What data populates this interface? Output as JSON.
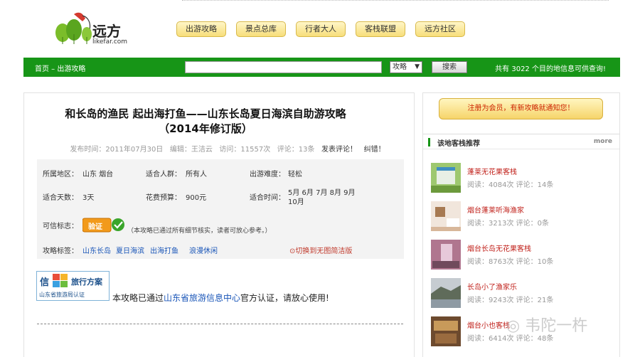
{
  "header": {
    "logo_text": "远方",
    "logo_sub": "likefar.com",
    "nav": [
      "出游攻略",
      "景点总库",
      "行者大人",
      "客栈联盟",
      "远方社区"
    ]
  },
  "searchbar": {
    "breadcrumb": "首页 – 出游攻略",
    "search_value": "",
    "select_value": "攻略",
    "search_button": "搜索",
    "count_text": "共有 3022 个目的地信息可供查询!"
  },
  "article": {
    "title_line1": "和长岛的渔民   起出海打鱼——山东长岛夏日海滨自助游攻略",
    "title_line2": "（2014年修订版）",
    "meta": {
      "date": "发布时间：2011年07月30日",
      "editor": "编辑：王洁云",
      "views": "访问：11557次",
      "comments": "评论：13条",
      "comment_link": "发表评论！",
      "error_link": "纠错！"
    },
    "info": {
      "region_label": "所属地区：",
      "region_value": "山东 烟台",
      "crowd_label": "适合人群：",
      "crowd_value": "所有人",
      "difficulty_label": "出游难度：",
      "difficulty_value": "轻松",
      "days_label": "适合天数：",
      "days_value": "3天",
      "budget_label": "花费预算：",
      "budget_value": "900元",
      "season_label": "适合时间：",
      "season_value_1": "5月 6月 7月 8月 9月",
      "season_value_2": "10月",
      "trust_label": "可信标志：",
      "trust_badge": "验证",
      "trust_note": "（本攻略已通过所有细节核实，读者可放心参考。）",
      "tags_label": "攻略标签：",
      "tags": [
        "山东长岛",
        "夏日海滨",
        "出海打鱼",
        "浪漫休闲"
      ],
      "switch_link": "⊙切换到无图简洁版"
    },
    "cert": {
      "badge_char": "信",
      "badge_plan": "旅行方案",
      "badge_sub": "山东省旅游局认证",
      "text_prefix": "本攻略已通过",
      "text_highlight": "山东省旅游信息中心",
      "text_suffix": "官方认证，请放心使用!"
    }
  },
  "sidebar": {
    "register_button": "注册为会员，有新攻略就通知您！",
    "section_title": "该地客栈推荐",
    "more_label": "more",
    "hotels": [
      {
        "name": "蓬莱无花果客栈",
        "stats": "阅读：4084次  评论：14条"
      },
      {
        "name": "烟台蓬莱听海渔家",
        "stats": "阅读：3213次  评论：0条"
      },
      {
        "name": "烟台长岛无花果客栈",
        "stats": "阅读：8763次  评论：10条"
      },
      {
        "name": "长岛小了渔家乐",
        "stats": "阅读：9243次  评论：21条"
      },
      {
        "name": "烟台小也客栈",
        "stats": "阅读：6414次  评论：48条"
      }
    ]
  },
  "watermark": "韦陀一杵",
  "colors": {
    "green_bar": "#179517",
    "link_blue": "#1a56b8",
    "link_red": "#c0201a"
  }
}
